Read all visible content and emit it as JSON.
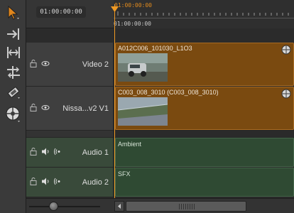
{
  "header": {
    "timecode": "01:00:00:00",
    "ruler_timecode": "01:00:00:00",
    "ruler_timecode_secondary": "01:00:00:00"
  },
  "tools": [
    {
      "name": "selection-tool-icon"
    },
    {
      "name": "track-select-forward-icon"
    },
    {
      "name": "ripple-trim-icon"
    },
    {
      "name": "slip-tool-icon"
    },
    {
      "name": "razor-tool-icon"
    },
    {
      "name": "audio-waveform-tool-icon"
    }
  ],
  "tracks": {
    "video2": {
      "label": "Video 2",
      "clip_name": "A012C006_101030_L1O3"
    },
    "video1": {
      "label": "Nissa...v2 V1",
      "clip_name": "C003_008_3010 (C003_008_3010)"
    },
    "audio1": {
      "label": "Audio 1",
      "clip_name": "Ambient"
    },
    "audio2": {
      "label": "Audio 2",
      "clip_name": "SFX"
    }
  },
  "colors": {
    "accent": "#f09a24",
    "video_clip": "#7a4a10",
    "audio_track": "#2e3e30"
  }
}
